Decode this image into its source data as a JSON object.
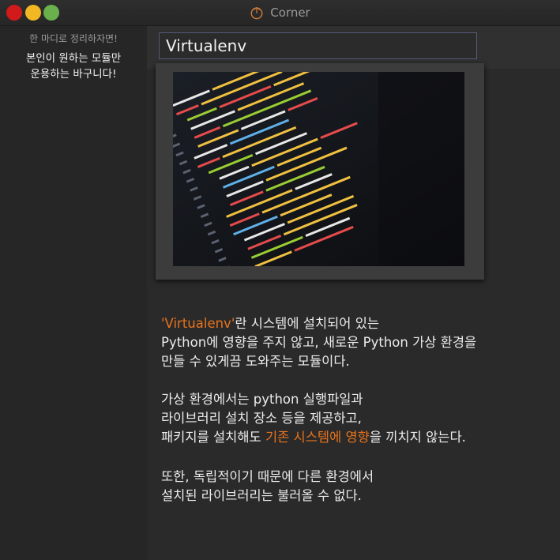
{
  "window": {
    "title": "Corner",
    "controls": [
      "close",
      "minimize",
      "maximize"
    ]
  },
  "sidebar": {
    "line1": "한 마디로 정리하자면!",
    "line2": "본인이 원하는 모듈만",
    "line3": "운용하는 바구니다!"
  },
  "note": {
    "title": "Virtualenv",
    "image_icon": "code-screenshot-image"
  },
  "paragraphs": {
    "p1": {
      "l1_hl": "'Virtualenv'",
      "l1_rest": "란 시스템에 설치되어 있는",
      "l2": "Python에 영향을 주지 않고, 새로운 Python 가상 환경을",
      "l3": "만들 수 있게끔 도와주는 모듈이다."
    },
    "p2": {
      "l1": "가상 환경에서는 python 실행파일과",
      "l2": "라이브러리 설치 장소 등을 제공하고,",
      "l3_a": "패키지를 설치해도 ",
      "l3_hl": "기존 시스템에 영향",
      "l3_b": "을 끼치지 않는다."
    },
    "p3": {
      "l1": "또한, 독립적이기 때문에 다른 환경에서",
      "l2": "설치된 라이브러리는 불러올 수 없다."
    }
  },
  "colors": {
    "accent": "#e8731c",
    "close": "#d11a1a",
    "minimize": "#f2b824",
    "maximize": "#6ab04c"
  }
}
